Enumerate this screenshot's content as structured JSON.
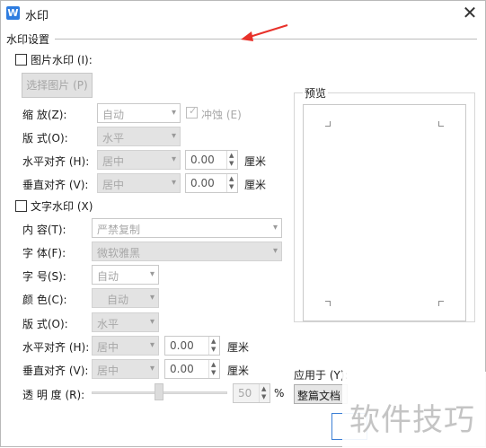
{
  "window": {
    "title": "水印",
    "icon": "wps-w-icon",
    "close_glyph": "✕"
  },
  "group": {
    "title": "水印设置"
  },
  "image_watermark": {
    "checkbox_label": "图片水印 (I):",
    "select_button": "选择图片 (P)",
    "scale_label": "缩    放(Z):",
    "scale_value": "自动",
    "washout_label": "冲蚀 (E)",
    "layout_label": "版    式(O):",
    "layout_value": "水平",
    "h_align_label": "水平对齐 (H):",
    "h_align_value": "居中",
    "h_offset": "0.00",
    "h_unit": "厘米",
    "v_align_label": "垂直对齐 (V):",
    "v_align_value": "居中",
    "v_offset": "0.00",
    "v_unit": "厘米"
  },
  "text_watermark": {
    "checkbox_label": "文字水印 (X)",
    "content_label": "内    容(T):",
    "content_value": "严禁复制",
    "font_label": "字    体(F):",
    "font_value": "微软雅黑",
    "size_label": "字    号(S):",
    "size_value": "自动",
    "color_label": "颜    色(C):",
    "color_value": "自动",
    "layout_label": "版    式(O):",
    "layout_value": "水平",
    "h_align_label": "水平对齐 (H):",
    "h_align_value": "居中",
    "h_offset": "0.00",
    "h_unit": "厘米",
    "v_align_label": "垂直对齐 (V):",
    "v_align_value": "居中",
    "v_offset": "0.00",
    "v_unit": "厘米",
    "opacity_label": "透 明 度 (R):",
    "opacity_value": "50",
    "opacity_unit": "%"
  },
  "preview": {
    "label": "预览"
  },
  "apply": {
    "label": "应用于 (Y):",
    "value": "整篇文档"
  },
  "overlay": {
    "watermark_text": "软件技巧"
  },
  "colors": {
    "accent": "#2f7de0",
    "annotation_arrow": "#e8312a"
  }
}
